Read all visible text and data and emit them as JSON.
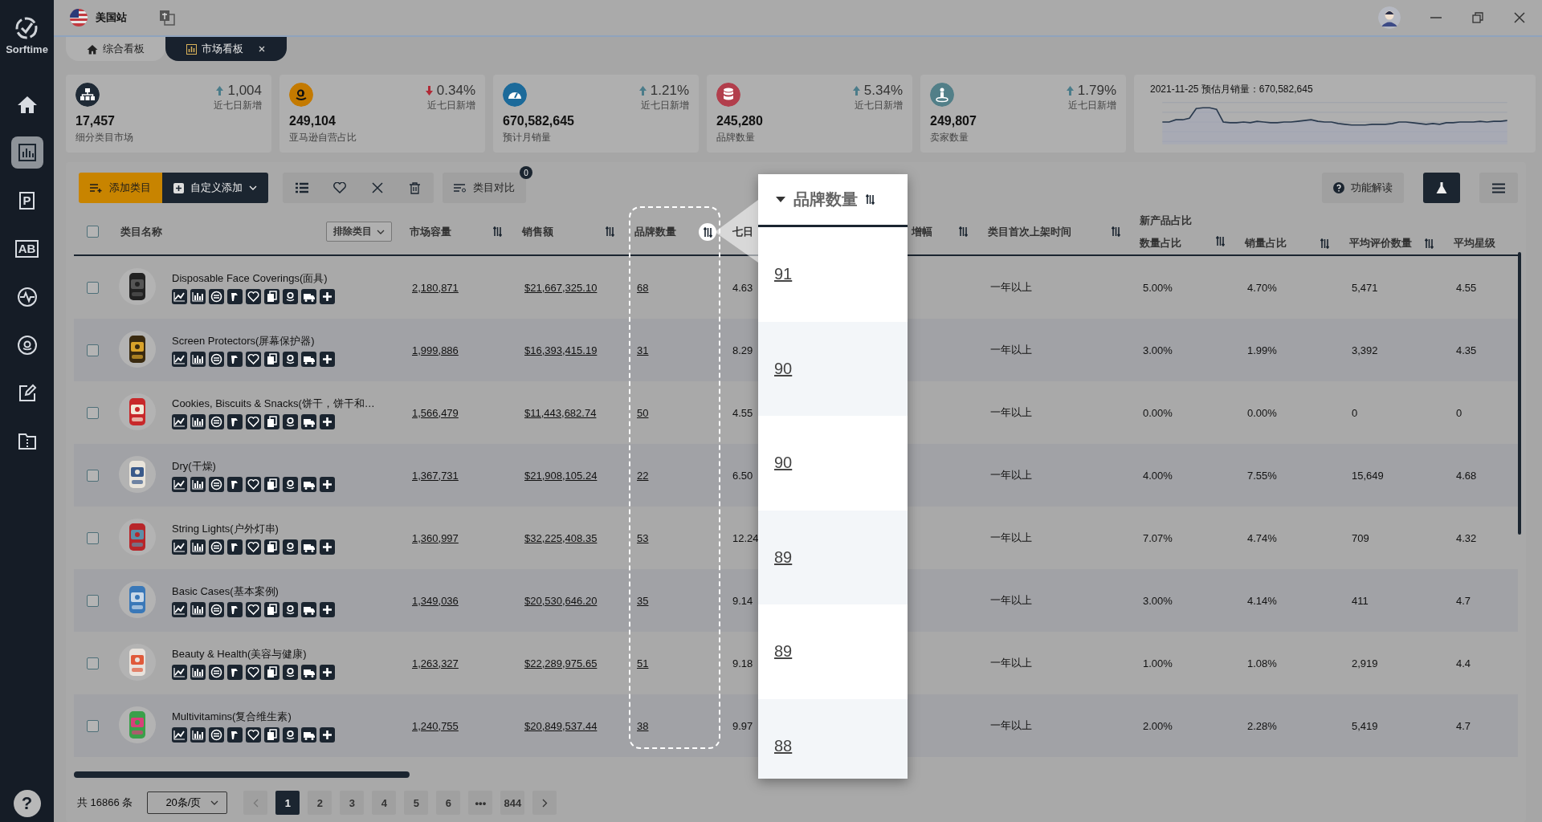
{
  "top_bar": {
    "site": "美国站"
  },
  "sidebar": {
    "logo": "Sorftime",
    "items": [
      {
        "kind": "home",
        "selected": false
      },
      {
        "kind": "chart",
        "selected": true
      },
      {
        "kind": "letter",
        "glyph": "P",
        "selected": false
      },
      {
        "kind": "letter",
        "glyph": "AB",
        "selected": false
      },
      {
        "kind": "pulse",
        "selected": false
      },
      {
        "kind": "smile",
        "selected": false
      },
      {
        "kind": "edit",
        "selected": false
      },
      {
        "kind": "folder",
        "selected": false
      }
    ],
    "help": "?"
  },
  "tabs": [
    {
      "label": "综合看板",
      "selected": false,
      "closable": false
    },
    {
      "label": "市场看板",
      "selected": true,
      "closable": true
    }
  ],
  "stats": [
    {
      "kind": "network",
      "value": "17,457",
      "label": "细分类目市场",
      "change": "1,004",
      "up": true,
      "change_label": "近七日新增",
      "color": "#1f2a36"
    },
    {
      "kind": "smile",
      "value": "249,104",
      "label": "亚马逊自营占比",
      "change": "0.34%",
      "up": false,
      "change_label": "近七日新增",
      "color": "#c47a00"
    },
    {
      "kind": "gauge",
      "value": "670,582,645",
      "label": "预计月销量",
      "change": "1.21%",
      "up": true,
      "change_label": "近七日新增",
      "color": "#1c6a9a"
    },
    {
      "kind": "database",
      "value": "245,280",
      "label": "品牌数量",
      "change": "5.34%",
      "up": true,
      "change_label": "近七日新增",
      "color": "#b23e4c"
    },
    {
      "kind": "seller",
      "value": "249,807",
      "label": "卖家数量",
      "change": "1.79%",
      "up": true,
      "change_label": "近七日新增",
      "color": "#527f88"
    }
  ],
  "trend_card": {
    "title": "2021-11-25 预估月销量：670,582,645"
  },
  "toolbar": {
    "add": "添加类目",
    "custom": "自定义添加",
    "compare": "类目对比",
    "compare_count": "0",
    "help": "功能解读"
  },
  "table": {
    "columns": {
      "name": "类目名称",
      "exclude": "排除类目",
      "capacity": "市场容量",
      "sales": "销售额",
      "brands": "品牌数量",
      "week": "七日",
      "growth": "增幅",
      "first_listed": "类目首次上架时间",
      "new_group": "新产品占比",
      "new_count": "数量占比",
      "new_sales": "销量占比",
      "reviews": "平均评价数量",
      "rating": "平均星级"
    },
    "all_checked": false,
    "rows": [
      {
        "checked": false,
        "name": "Disposable Face Coverings(面具)",
        "capacity": "2,180,871",
        "sales": "$21,667,325.10",
        "brands": "68",
        "week": "4.63",
        "first_listed": "一年以上",
        "new_count": "5.00%",
        "new_sales": "4.70%",
        "reviews": "5,471",
        "rating": "4.55"
      },
      {
        "checked": false,
        "name": "Screen Protectors(屏幕保护器)",
        "capacity": "1,999,886",
        "sales": "$16,393,415.19",
        "brands": "31",
        "week": "8.29",
        "first_listed": "一年以上",
        "new_count": "3.00%",
        "new_sales": "1.99%",
        "reviews": "3,392",
        "rating": "4.35"
      },
      {
        "checked": false,
        "name": "Cookies, Biscuits & Snacks(饼干，饼干和…",
        "capacity": "1,566,479",
        "sales": "$11,443,682.74",
        "brands": "50",
        "week": "4.55",
        "first_listed": "一年以上",
        "new_count": "0.00%",
        "new_sales": "0.00%",
        "reviews": "0",
        "rating": "0"
      },
      {
        "checked": false,
        "name": "Dry(干燥)",
        "capacity": "1,367,731",
        "sales": "$21,908,105.24",
        "brands": "22",
        "week": "6.50",
        "first_listed": "一年以上",
        "new_count": "4.00%",
        "new_sales": "7.55%",
        "reviews": "15,649",
        "rating": "4.68"
      },
      {
        "checked": false,
        "name": "String Lights(户外灯串)",
        "capacity": "1,360,997",
        "sales": "$32,225,408.35",
        "brands": "53",
        "week": "12.24",
        "first_listed": "一年以上",
        "new_count": "7.07%",
        "new_sales": "4.74%",
        "reviews": "709",
        "rating": "4.32"
      },
      {
        "checked": false,
        "name": "Basic Cases(基本案例)",
        "capacity": "1,349,036",
        "sales": "$20,530,646.20",
        "brands": "35",
        "week": "9.14",
        "first_listed": "一年以上",
        "new_count": "3.00%",
        "new_sales": "4.14%",
        "reviews": "411",
        "rating": "4.7"
      },
      {
        "checked": false,
        "name": "Beauty & Health(美容与健康)",
        "capacity": "1,263,327",
        "sales": "$22,289,975.65",
        "brands": "51",
        "week": "9.18",
        "first_listed": "一年以上",
        "new_count": "1.00%",
        "new_sales": "1.08%",
        "reviews": "2,919",
        "rating": "4.4"
      },
      {
        "checked": false,
        "name": "Multivitamins(复合维生素)",
        "capacity": "1,240,755",
        "sales": "$20,849,537.44",
        "brands": "38",
        "week": "9.97",
        "first_listed": "一年以上",
        "new_count": "2.00%",
        "new_sales": "2.28%",
        "reviews": "5,419",
        "rating": "4.7"
      }
    ]
  },
  "spotlight": {
    "header": "品牌数量",
    "values": [
      "91",
      "90",
      "90",
      "89",
      "89",
      "88"
    ]
  },
  "pagination": {
    "total": "共 16866 条",
    "page_size": "20条/页",
    "pages": [
      {
        "label": "1",
        "selected": true
      },
      {
        "label": "2",
        "selected": false
      },
      {
        "label": "3",
        "selected": false
      },
      {
        "label": "4",
        "selected": false
      },
      {
        "label": "5",
        "selected": false
      },
      {
        "label": "6",
        "selected": false
      },
      {
        "label": "•••",
        "selected": false
      },
      {
        "label": "844",
        "selected": false
      }
    ]
  }
}
